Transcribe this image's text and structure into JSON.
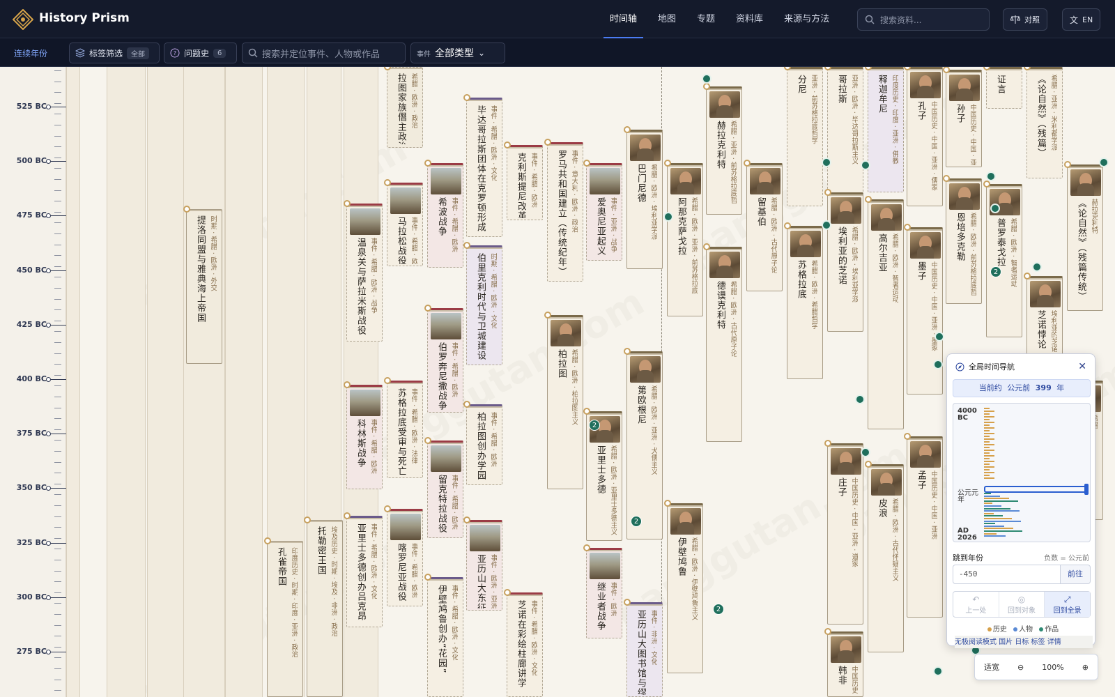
{
  "app": {
    "title": "History Prism"
  },
  "nav": {
    "items": [
      "时间轴",
      "地图",
      "专题",
      "资料库",
      "来源与方法"
    ],
    "active": "时间轴"
  },
  "search": {
    "placeholder": "搜索资料..."
  },
  "header_buttons": {
    "compare": "对照",
    "lang": "EN"
  },
  "filters": {
    "continuous_years": "连续年份",
    "tag_filter": "标签筛选",
    "tag_filter_value": "全部",
    "question_history": "问题史",
    "question_history_count": "6",
    "locate_placeholder": "搜索并定位事件、人物或作品",
    "type_label": "事件",
    "type_value": "全部类型"
  },
  "ruler": {
    "ticks": [
      "525 BC",
      "500 BC",
      "475 BC",
      "450 BC",
      "425 BC",
      "400 BC",
      "375 BC",
      "350 BC",
      "325 BC",
      "300 BC",
      "275 BC"
    ]
  },
  "cards": [
    {
      "title": "提洛同盟与雅典海上帝国",
      "tags": "时期 · 希腊 · 欧洲 · 外交"
    },
    {
      "title": "孔雀帝国",
      "tags": "印度历史 · 时期 · 印度 · 亚洲 · 政治"
    },
    {
      "title": "托勒密王国",
      "tags": "埃及历史 · 时期 · 埃及 · 非洲 · 政治"
    },
    {
      "title": "温泉关与萨拉米斯战役",
      "tags": "事件 · 希腊 · 欧洲 · 战争"
    },
    {
      "title": "科林斯战争",
      "tags": "事件 · 希腊 · 欧洲"
    },
    {
      "title": "亚里士多德创办吕克昂",
      "tags": "事件 · 希腊 · 欧洲 · 文化"
    },
    {
      "title": "拉图家族僭主政治",
      "tags": "希腊 · 欧洲 · 政治"
    },
    {
      "title": "马拉松战役",
      "tags": "事件 · 希腊 · 欧洲"
    },
    {
      "title": "苏格拉底受审与死亡",
      "tags": "事件 · 希腊 · 欧洲 · 法律"
    },
    {
      "title": "喀罗尼亚战役",
      "tags": "事件 · 希腊 · 欧洲"
    },
    {
      "title": "希波战争",
      "tags": "事件 · 希腊 · 欧洲"
    },
    {
      "title": "伯罗奔尼撒战争",
      "tags": "事件 · 希腊 · 欧洲"
    },
    {
      "title": "留克特拉战役",
      "tags": "事件 · 希腊 · 欧洲"
    },
    {
      "title": "伊壁鸠鲁创办“花园”",
      "tags": "事件 · 希腊 · 欧洲 · 文化"
    },
    {
      "title": "毕达哥拉斯团体在克罗顿形成",
      "tags": "事件 · 希腊 · 欧洲 · 文化"
    },
    {
      "title": "伯里克利时代与卫城建设",
      "tags": "时期 · 希腊 · 欧洲 · 文化"
    },
    {
      "title": "柏拉图创办学园",
      "tags": "事件 · 希腊 · 欧洲"
    },
    {
      "title": "亚历山大东征",
      "tags": "事件 · 欧洲 · 亚洲"
    },
    {
      "title": "克利斯提尼改革",
      "tags": "事件 · 希腊 · 欧洲"
    },
    {
      "title": "芝诺在彩绘柱廊讲学",
      "tags": "事件 · 希腊 · 欧洲 · 文化"
    },
    {
      "title": "罗马共和国建立（传统纪年）",
      "tags": "事件 · 意大利 · 欧洲 · 政治"
    },
    {
      "title": "柏拉图",
      "tags": "希腊 · 欧洲 · 柏拉图主义"
    },
    {
      "title": "爱奥尼亚起义",
      "tags": "事件 · 亚洲 · 战争"
    },
    {
      "title": "亚里士多德",
      "tags": "希腊 · 欧洲 · 亚里士多德主义"
    },
    {
      "title": "继业者战争",
      "tags": "事件 · 欧洲"
    },
    {
      "title": "巴门尼德",
      "tags": "希腊 · 欧洲 · 埃利亚学派"
    },
    {
      "title": "第欧根尼",
      "tags": "希腊 · 欧洲 · 亚洲 · 犬儒主义"
    },
    {
      "title": "亚历山大图书馆与缪斯",
      "tags": "事件 · 非洲 · 文化"
    },
    {
      "title": "阿那克萨戈拉",
      "tags": "希腊 · 欧洲 · 亚洲 · 前苏格拉底"
    },
    {
      "title": "伊壁鸠鲁",
      "tags": "希腊 · 欧洲 · 伊壁鸠鲁主义"
    },
    {
      "title": "赫拉克利特",
      "tags": "希腊 · 亚洲 · 前苏格拉底哲"
    },
    {
      "title": "德谟克利特",
      "tags": "希腊 · 欧洲 · 古代原子论"
    },
    {
      "title": "留基伯",
      "tags": "希腊 · 欧洲 · 古代原子论"
    },
    {
      "title": "苏格拉底",
      "tags": "希腊 · 欧洲 · 希腊哲学"
    },
    {
      "title": "分尼",
      "tags": "亚洲 · 前苏格拉底哲学"
    },
    {
      "title": "庄子",
      "tags": "中国历史 · 中国 · 亚洲 · 道家"
    },
    {
      "title": "哥拉斯",
      "tags": "亚洲 · 欧洲 · 毕达哥拉斯主义"
    },
    {
      "title": "埃利亚的芝诺",
      "tags": "希腊 · 欧洲 · 埃利亚学派"
    },
    {
      "title": "释迦牟尼",
      "tags": "印度历史 · 印度 · 亚洲 · 佛教"
    },
    {
      "title": "高尔吉亚",
      "tags": "希腊 · 欧洲 · 智者运动"
    },
    {
      "title": "皮浪",
      "tags": "希腊 · 欧洲 · 古代怀疑主义"
    },
    {
      "title": "孔子",
      "tags": "中国历史 · 中国 · 亚洲 · 儒家"
    },
    {
      "title": "墨子",
      "tags": "中国历史 · 中国 · 亚洲 · 墨家"
    },
    {
      "title": "孟子",
      "tags": "中国历史 · 中国 · 亚洲"
    },
    {
      "title": "孙子",
      "tags": "中国历史 · 中国 · 亚洲"
    },
    {
      "title": "恩培多克勒",
      "tags": "希腊 · 欧洲 · 前苏格拉底哲"
    },
    {
      "title": "普罗泰戈拉",
      "tags": "希腊 · 欧洲 · 智者运动"
    },
    {
      "title": "证言",
      "tags": ""
    },
    {
      "title": "《论自然》（残篇）",
      "tags": "希腊 · 亚洲 · 米利都学派"
    },
    {
      "title": "芝诺悖论",
      "tags": "埃利亚的芝诺 · 欧洲"
    },
    {
      "title": "《论自然》（残篇传统）",
      "tags": "赫拉克利特"
    },
    {
      "title": "韩非",
      "tags": "中国历史"
    },
    {
      "title": "苏格拉底",
      "tags": "希腊"
    }
  ],
  "counts": [
    "2",
    "2",
    "2",
    "2"
  ],
  "navigator": {
    "title": "全局时间导航",
    "current_prefix": "当前约",
    "current_era": "公元前",
    "current_year": "399",
    "current_suffix": "年",
    "mini_top": "4000\nBC",
    "mini_mid": "公元元\n年",
    "mini_bottom": "AD\n2026",
    "jump_label": "跳到年份",
    "jump_hint": "负数 = 公元前",
    "jump_value": "-450",
    "go": "前往",
    "prev": "上一处",
    "back_object": "回到对象",
    "back_all": "回到全景",
    "legend": [
      "历史",
      "人物",
      "作品"
    ],
    "modes": "无极阅读模式  国片  日标  标签  详情"
  },
  "zoom": {
    "fit": "适宽",
    "level": "100%"
  },
  "colors": {
    "accent": "#4b7cf3",
    "history": "#d6a04a",
    "person": "#5a8ad5",
    "work": "#2e8a73"
  }
}
